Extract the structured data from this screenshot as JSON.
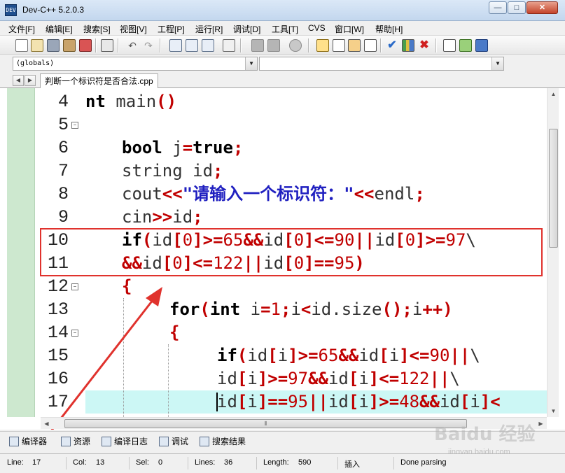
{
  "window": {
    "title": "Dev-C++ 5.2.0.3",
    "icon_label": "DEV",
    "controls": {
      "minimize": "—",
      "maximize": "□",
      "close": "✕"
    }
  },
  "menu": {
    "items": [
      "文件[F]",
      "编辑[E]",
      "搜索[S]",
      "视图[V]",
      "工程[P]",
      "运行[R]",
      "调试[D]",
      "工具[T]",
      "CVS",
      "窗口[W]",
      "帮助[H]"
    ]
  },
  "toolbar": {
    "icons": [
      "new-file-icon",
      "open-file-icon",
      "save-icon",
      "save-all-icon",
      "close-file-icon",
      "print-icon",
      "undo-icon",
      "redo-icon",
      "find-icon",
      "find-replace-icon",
      "find-next-icon",
      "goto-line-icon",
      "indent-left-icon",
      "indent-right-icon",
      "toggle-comment-icon",
      "new-project-icon",
      "project-window-icon",
      "class-browser-icon",
      "grid-icon",
      "compile-icon",
      "chart-icon",
      "delete-icon",
      "exit-icon",
      "add-file-icon",
      "remove-file-icon"
    ]
  },
  "combos": {
    "scope_value": "(globals)",
    "function_value": ""
  },
  "tabs": {
    "file_tab": "判断一个标识符是否合法.cpp"
  },
  "editor": {
    "lines": [
      {
        "num": "4"
      },
      {
        "num": "5"
      },
      {
        "num": "6"
      },
      {
        "num": "7"
      },
      {
        "num": "8"
      },
      {
        "num": "9"
      },
      {
        "num": "10"
      },
      {
        "num": "11"
      },
      {
        "num": "12"
      },
      {
        "num": "13"
      },
      {
        "num": "14"
      },
      {
        "num": "15"
      },
      {
        "num": "16"
      },
      {
        "num": "17"
      }
    ],
    "code": {
      "l4_kw": "nt",
      "l4_id": " main",
      "l4_op": "()",
      "l6_kw": "bool",
      "l6_id": " j",
      "l6_op1": "=",
      "l6_kw2": "true",
      "l6_op2": ";",
      "l7_id": "string id",
      "l7_op": ";",
      "l8_id": "cout",
      "l8_op1": "<<",
      "l8_str": "\"请输入一个标识符：\"",
      "l8_op2": "<<",
      "l8_id2": "endl",
      "l8_op3": ";",
      "l9_id": "cin",
      "l9_op1": ">>",
      "l9_id2": "id",
      "l9_op2": ";",
      "l12_op": "{",
      "l14_op": "{"
    }
  },
  "bottom_tabs": [
    "编译器",
    "资源",
    "编译日志",
    "调试",
    "搜索结果"
  ],
  "status": {
    "line_label": "Line:",
    "line_value": "17",
    "col_label": "Col:",
    "col_value": "13",
    "sel_label": "Sel:",
    "sel_value": "0",
    "lines_label": "Lines:",
    "lines_value": "36",
    "length_label": "Length:",
    "length_value": "590",
    "mode": "插入",
    "parse_status": "Done parsing"
  },
  "watermark": {
    "text": "Baidu 经验",
    "sub": "jingyan.baidu.com"
  },
  "colors": {
    "keyword": "#000000",
    "operator": "#c00000",
    "string": "#2020c0",
    "margin": "#cde8cf",
    "highlight_line": "#ccf7f5",
    "annotation": "#e0322d"
  }
}
